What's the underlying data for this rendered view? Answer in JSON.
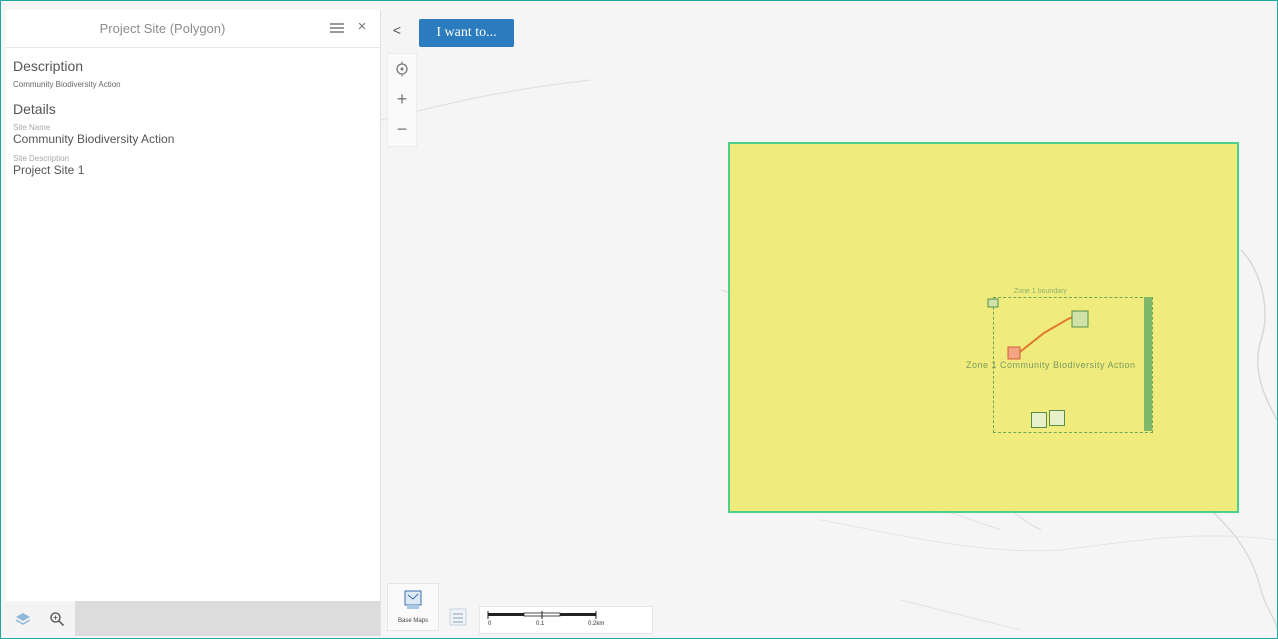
{
  "panel": {
    "title": "Project Site (Polygon)",
    "description_heading": "Description",
    "description_text": "Community Biodiversity Action",
    "details_heading": "Details",
    "fields": [
      {
        "label": "Site Name",
        "value": "Community Biodiversity Action"
      },
      {
        "label": "Site Description",
        "value": "Project Site 1"
      }
    ]
  },
  "toolbar": {
    "want_label": "I want to...",
    "collapse_glyph": "<",
    "zoom_in": "+",
    "zoom_out": "−"
  },
  "map": {
    "polygon_fill": "#eeeb6c",
    "polygon_border": "#4ed08a",
    "zone_label": "Zone 1 Community Biodiversity Action",
    "zone_top_label": "Zone 1 boundary"
  },
  "bottom": {
    "basemaps_label": "Base Maps",
    "scale_labels": [
      "0",
      "0.1",
      "0.2km"
    ]
  },
  "icons": {
    "menu": "menu-icon",
    "close": "close-icon",
    "locate": "locate-icon",
    "layers": "layers-icon",
    "search": "search-icon",
    "basemaps": "basemaps-icon",
    "legend": "legend-icon"
  },
  "colors": {
    "accent": "#2b7bbf",
    "frame": "#22a7a0"
  }
}
